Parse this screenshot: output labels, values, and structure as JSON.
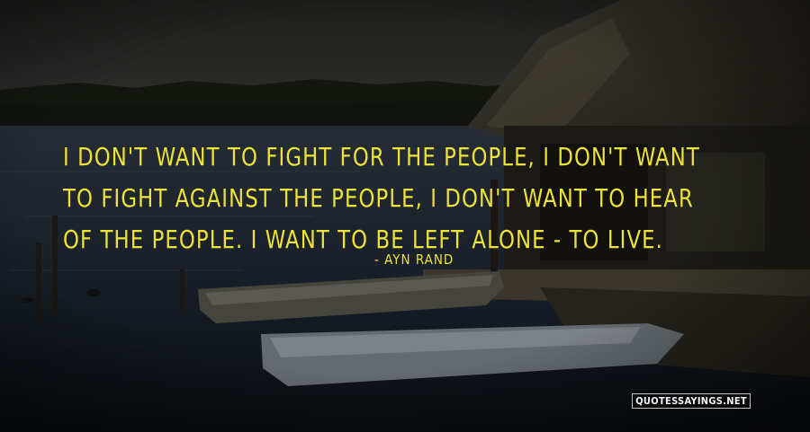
{
  "quote": {
    "text": "I don't want to fight for the people, I don't want to fight against the people, I don't want to hear of the people. I want to be left alone - to live.",
    "author_line": "- Ayn Rand",
    "text_color": "#ece23a"
  },
  "watermark": {
    "text": "QUOTESSAYINGS.NET"
  },
  "scene": {
    "description_icon": "lakeside-boathouse-photo",
    "sky_color": "#3a3d3e",
    "water_color": "#2c3540"
  }
}
